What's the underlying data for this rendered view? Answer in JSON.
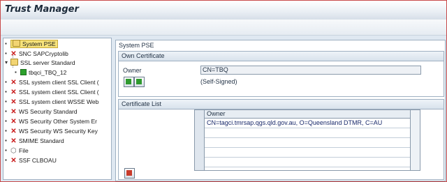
{
  "window": {
    "title": "Trust Manager"
  },
  "tree": {
    "items": [
      {
        "label": "System PSE",
        "icon": "folder-icon",
        "selected": true
      },
      {
        "label": "SNC SAPCryptolib",
        "icon": "x-icon"
      },
      {
        "label": "SSL server Standard",
        "icon": "folder-icon"
      },
      {
        "label": "tbqci_TBQ_12",
        "icon": "green-square-icon",
        "child": true
      },
      {
        "label": "SSL system client SSL Client (",
        "icon": "x-icon"
      },
      {
        "label": "SSL system client SSL Client (",
        "icon": "x-icon"
      },
      {
        "label": "SSL system client WSSE Web",
        "icon": "x-icon"
      },
      {
        "label": "WS Security Standard",
        "icon": "x-icon"
      },
      {
        "label": "WS Security Other System Er",
        "icon": "x-icon"
      },
      {
        "label": "WS Security WS Security Key",
        "icon": "x-icon"
      },
      {
        "label": "SMIME Standard",
        "icon": "x-icon"
      },
      {
        "label": "File",
        "icon": "gear-icon"
      },
      {
        "label": "SSF CLBOAU",
        "icon": "x-icon"
      }
    ]
  },
  "pse": {
    "title": "System PSE",
    "own_certificate": {
      "title": "Own Certificate",
      "owner_label": "Owner",
      "owner_value": "CN=TBQ",
      "status": "(Self-Signed)"
    },
    "certificate_list": {
      "title": "Certificate List",
      "column_owner": "Owner",
      "rows": [
        "CN=tagci.tmrsap.qgs.qld.gov.au, O=Queensland DTMR, C=AU",
        "",
        "",
        "",
        "",
        ""
      ]
    }
  },
  "colors": {
    "accent": "#243447",
    "error_icon": "#c81818",
    "selection": "#f7e37a"
  }
}
